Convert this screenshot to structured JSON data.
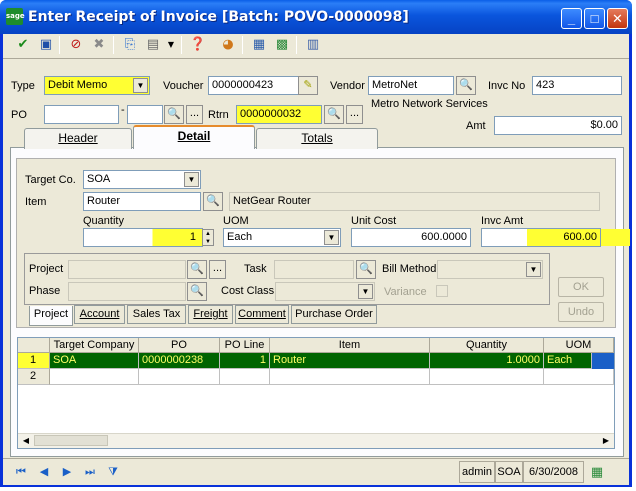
{
  "window": {
    "logo_text": "sage",
    "title": "Enter Receipt of Invoice [Batch: POVO-0000098]",
    "minimize": "_",
    "maximize": "□",
    "close": "✕"
  },
  "toolbar": {
    "icons": [
      "check-icon",
      "save-icon",
      "cancel-icon",
      "delete-icon",
      "export-icon",
      "page-icon",
      "help-icon",
      "chart-icon",
      "grid-icon",
      "grid-remove-icon",
      "calculator-icon"
    ]
  },
  "header": {
    "type_label": "Type",
    "type_value": "Debit Memo",
    "voucher_label": "Voucher",
    "voucher_value": "0000000423",
    "vendor_label": "Vendor",
    "vendor_value": "MetroNet",
    "vendor_name": "Metro Network Services",
    "invc_no_label": "Invc No",
    "invc_no_value": "423",
    "po_label": "PO",
    "po_value": "",
    "po_release": "",
    "rtrn_label": "Rtrn",
    "rtrn_value": "0000000032",
    "amt_label": "Amt",
    "amt_value": "$0.00"
  },
  "tabs": [
    {
      "label": "Header"
    },
    {
      "label": "Detail"
    },
    {
      "label": "Totals"
    }
  ],
  "detail": {
    "target_co_label": "Target Co.",
    "target_co_value": "SOA",
    "item_label": "Item",
    "item_value": "Router",
    "item_desc": "NetGear Router",
    "quantity_label": "Quantity",
    "quantity_value": "1",
    "uom_label": "UOM",
    "uom_value": "Each",
    "unit_cost_label": "Unit Cost",
    "unit_cost_value": "600.0000",
    "invc_amt_label": "Invc Amt",
    "invc_amt_value": "600.00",
    "project_label": "Project",
    "task_label": "Task",
    "bill_method_label": "Bill Method",
    "phase_label": "Phase",
    "cost_class_label": "Cost Class",
    "variance_label": "Variance",
    "ok_label": "OK",
    "undo_label": "Undo"
  },
  "subtabs": [
    {
      "label": "Project"
    },
    {
      "label": "Account"
    },
    {
      "label": "Sales Tax"
    },
    {
      "label": "Freight"
    },
    {
      "label": "Comment"
    },
    {
      "label": "Purchase Order"
    }
  ],
  "grid": {
    "columns": [
      "Target Company",
      "PO",
      "PO Line",
      "Item",
      "Quantity",
      "UOM"
    ],
    "rows": [
      {
        "num": "1",
        "target_company": "SOA",
        "po": "0000000238",
        "po_line": "1",
        "item": "Router",
        "quantity": "1.0000",
        "uom": "Each"
      },
      {
        "num": "2",
        "target_company": "",
        "po": "",
        "po_line": "",
        "item": "",
        "quantity": "",
        "uom": ""
      }
    ]
  },
  "status": {
    "user": "admin",
    "company": "SOA",
    "date": "6/30/2008"
  },
  "colors": {
    "titlebar": "#0a55dd",
    "highlight": "#ffff33",
    "selected_row": "#006400",
    "selected_row_text": "#ffff66"
  }
}
